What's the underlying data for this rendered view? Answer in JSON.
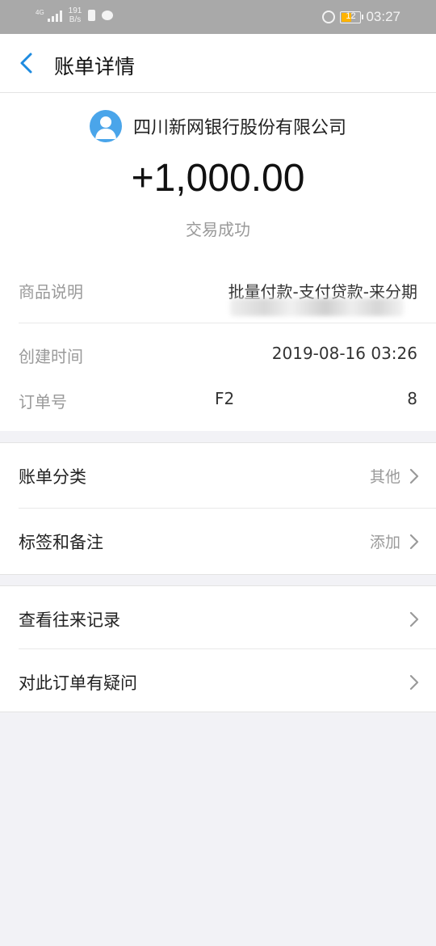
{
  "status_bar": {
    "signal": "4G",
    "net_speed_value": "191",
    "net_speed_unit": "B/s",
    "battery": "12",
    "time": "03:27"
  },
  "header": {
    "title": "账单详情"
  },
  "summary": {
    "merchant": "四川新网银行股份有限公司",
    "amount": "+1,000.00",
    "status": "交易成功"
  },
  "details": [
    {
      "label": "商品说明",
      "value": "批量付款-支付贷款-来分期"
    },
    {
      "label": "创建时间",
      "value": "2019-08-16 03:26"
    },
    {
      "label": "订单号",
      "value_prefix": "F2",
      "value_suffix": "8"
    }
  ],
  "group1": [
    {
      "label": "账单分类",
      "value": "其他"
    },
    {
      "label": "标签和备注",
      "value": "添加"
    }
  ],
  "group2": [
    {
      "label": "查看往来记录"
    },
    {
      "label": "对此订单有疑问"
    }
  ],
  "colors": {
    "accent": "#1e8be0",
    "avatar": "#4aa5ea",
    "status_bar": "#a9a9a9",
    "battery": "#ffb300"
  }
}
